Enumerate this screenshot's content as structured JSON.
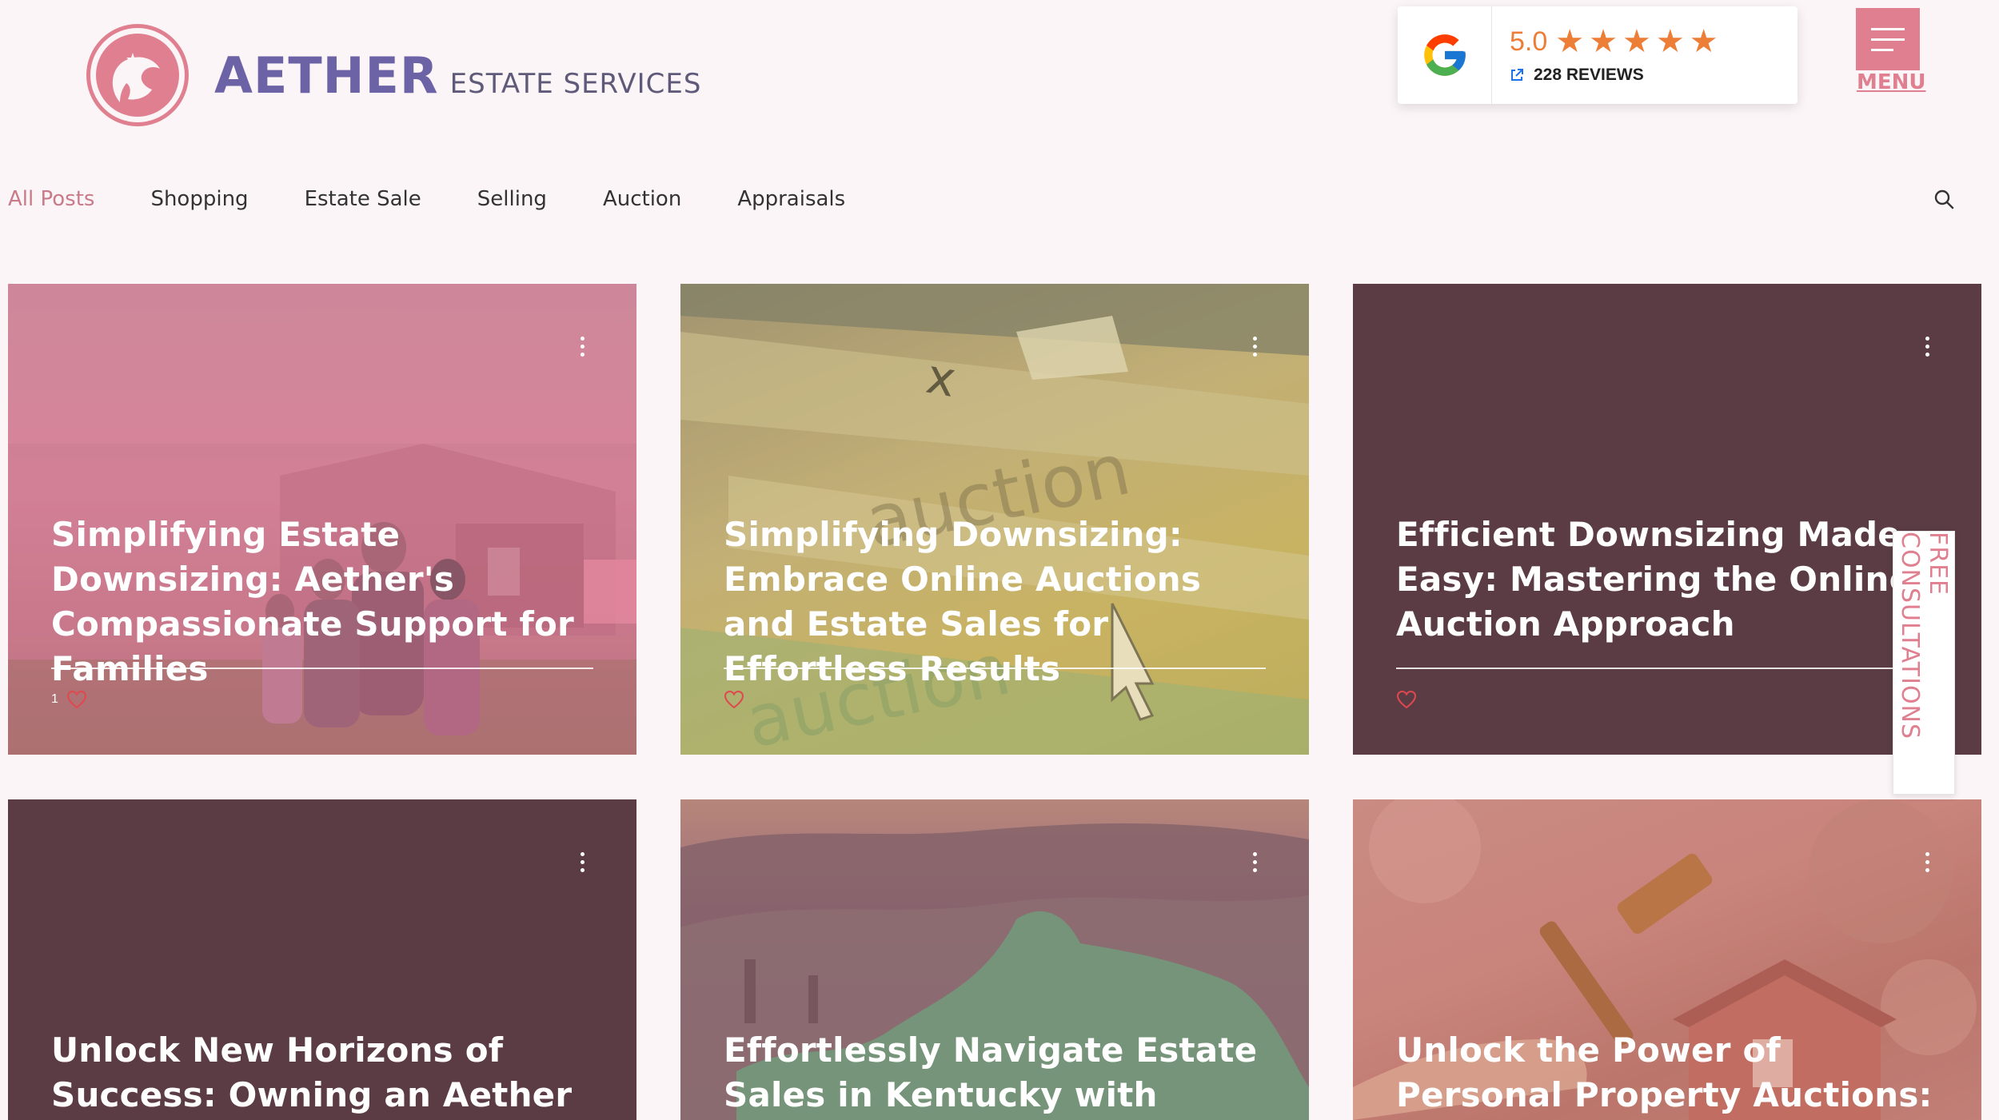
{
  "brand": {
    "name_main": "AETHER",
    "name_sub": "ESTATE SERVICES"
  },
  "reviews": {
    "score": "5.0",
    "stars": 5,
    "count_label": "228 REVIEWS",
    "star_color": "#ec7e37"
  },
  "menu": {
    "label": "MENU"
  },
  "categories": [
    "All Posts",
    "Shopping",
    "Estate Sale",
    "Selling",
    "Auction",
    "Appraisals"
  ],
  "posts": [
    {
      "title": "Simplifying Estate Downsizing: Aether's Compassionate Support for Families",
      "likes": "1",
      "overlay_color": "#e07f9c"
    },
    {
      "title": "Simplifying Downsizing: Embrace Online Auctions and Estate Sales for Effortless Results",
      "likes": "",
      "overlay_color": "#c9ad62"
    },
    {
      "title": "Efficient Downsizing Made Easy: Mastering the Online Auction Approach",
      "likes": "",
      "overlay_color": "#5b3c45"
    },
    {
      "title": "Unlock New Horizons of Success: Owning an Aether Franchise in",
      "overlay_color": "#5b3c45"
    },
    {
      "title": "Effortlessly Navigate Estate Sales in Kentucky with Aether Estate",
      "overlay_color": "#a86f7e"
    },
    {
      "title": "Unlock the Power of Personal Property Auctions: Why Aether",
      "overlay_color": "#c97b79"
    }
  ],
  "side_tab": {
    "label": "FREE CONSULTATIONS"
  },
  "colors": {
    "accent": "#e07f8f",
    "brand_purple": "#6c63a6",
    "background": "#fbf5f7"
  }
}
